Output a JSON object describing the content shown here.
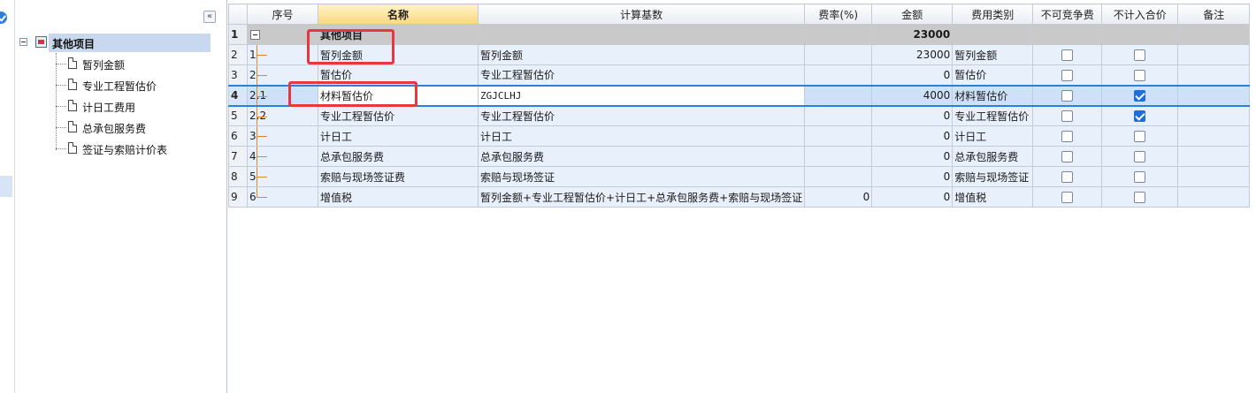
{
  "tree": {
    "collapse_label": "«",
    "root_label": "其他项目",
    "items": [
      {
        "label": "暂列金额"
      },
      {
        "label": "专业工程暂估价"
      },
      {
        "label": "计日工费用"
      },
      {
        "label": "总承包服务费"
      },
      {
        "label": "签证与索赔计价表"
      }
    ]
  },
  "grid": {
    "headers": [
      "序号",
      "名称",
      "计算基数",
      "费率(%)",
      "金额",
      "费用类别",
      "不可竞争费",
      "不计入合价",
      "备注"
    ],
    "rows": [
      {
        "row": "1",
        "seq": "",
        "name": "其他项目",
        "basis": "",
        "rate": "",
        "amount": "23000",
        "category": "",
        "noncompetitive": false,
        "excluded": false,
        "remark": ""
      },
      {
        "row": "2",
        "seq": "1",
        "name": "暂列金额",
        "basis": "暂列金额",
        "rate": "",
        "amount": "23000",
        "category": "暂列金额",
        "noncompetitive": false,
        "excluded": false,
        "remark": ""
      },
      {
        "row": "3",
        "seq": "2",
        "name": "暂估价",
        "basis": "专业工程暂估价",
        "rate": "",
        "amount": "0",
        "category": "暂估价",
        "noncompetitive": false,
        "excluded": false,
        "remark": ""
      },
      {
        "row": "4",
        "seq": "2.1",
        "name": "材料暂估价",
        "basis": "ZGJCLHJ",
        "rate": "",
        "amount": "4000",
        "category": "材料暂估价",
        "noncompetitive": false,
        "excluded": true,
        "remark": ""
      },
      {
        "row": "5",
        "seq": "2.2",
        "name": "专业工程暂估价",
        "basis": "专业工程暂估价",
        "rate": "",
        "amount": "0",
        "category": "专业工程暂估价",
        "noncompetitive": false,
        "excluded": true,
        "remark": ""
      },
      {
        "row": "6",
        "seq": "3",
        "name": "计日工",
        "basis": "计日工",
        "rate": "",
        "amount": "0",
        "category": "计日工",
        "noncompetitive": false,
        "excluded": false,
        "remark": ""
      },
      {
        "row": "7",
        "seq": "4",
        "name": "总承包服务费",
        "basis": "总承包服务费",
        "rate": "",
        "amount": "0",
        "category": "总承包服务费",
        "noncompetitive": false,
        "excluded": false,
        "remark": ""
      },
      {
        "row": "8",
        "seq": "5",
        "name": "索赔与现场签证费",
        "basis": "索赔与现场签证",
        "rate": "",
        "amount": "0",
        "category": "索赔与现场签证",
        "noncompetitive": false,
        "excluded": false,
        "remark": ""
      },
      {
        "row": "9",
        "seq": "6",
        "name": "增值税",
        "basis": "暂列金额+专业工程暂估价+计日工+总承包服务费+索赔与现场签证",
        "rate": "0",
        "amount": "0",
        "category": "增值税",
        "noncompetitive": false,
        "excluded": false,
        "remark": ""
      }
    ]
  },
  "colors": {
    "selection_border": "#2a7fe0",
    "annotation": "#e8383d",
    "checkbox_on": "#1e6fd9",
    "group_row": "#c9c9c9"
  }
}
